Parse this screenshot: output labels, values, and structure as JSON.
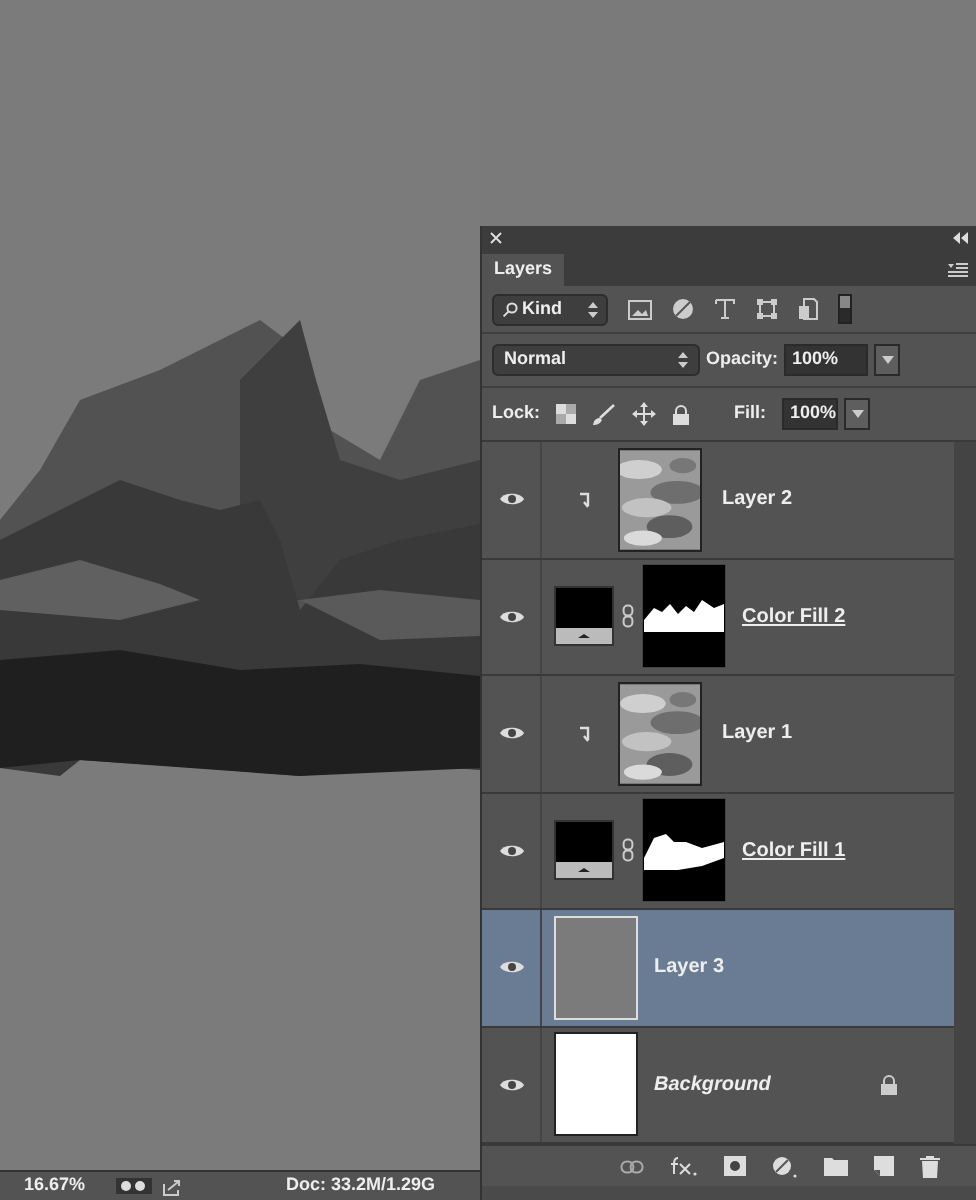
{
  "layers_panel": {
    "tab": "Layers",
    "filter": {
      "label": "Kind"
    },
    "blend_mode": "Normal",
    "opacity": {
      "label": "Opacity:",
      "value": "100%"
    },
    "lock": {
      "label": "Lock:"
    },
    "fill": {
      "label": "Fill:",
      "value": "100%"
    },
    "layers": [
      {
        "name": "Layer 2",
        "kind": "clipped",
        "visible": true,
        "selected": false,
        "locked": false
      },
      {
        "name": "Color Fill 2",
        "kind": "fill",
        "visible": true,
        "selected": false,
        "locked": false
      },
      {
        "name": "Layer 1",
        "kind": "clipped",
        "visible": true,
        "selected": false,
        "locked": false
      },
      {
        "name": "Color Fill 1",
        "kind": "fill",
        "visible": true,
        "selected": false,
        "locked": false
      },
      {
        "name": "Layer 3",
        "kind": "pixel",
        "visible": true,
        "selected": true,
        "locked": false
      },
      {
        "name": "Background",
        "kind": "background",
        "visible": true,
        "selected": false,
        "locked": true
      }
    ]
  },
  "status_bar": {
    "zoom": "16.67%",
    "doc": "Doc: 33.2M/1.29G"
  }
}
